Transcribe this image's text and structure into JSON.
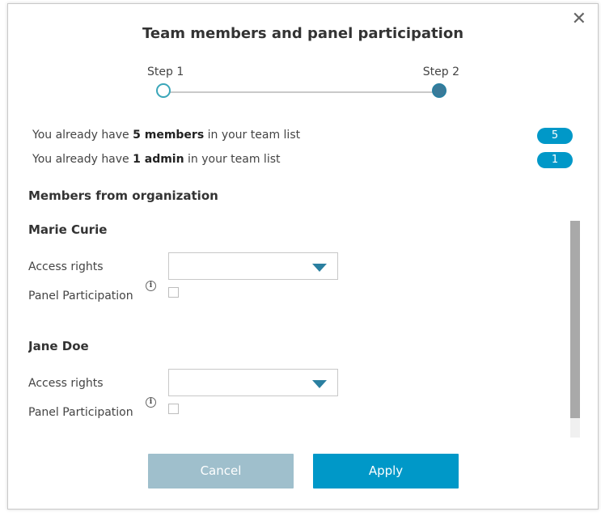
{
  "dialog": {
    "title": "Team members and panel participation",
    "close_glyph": "✕"
  },
  "stepper": {
    "steps": [
      {
        "label": "Step 1",
        "state": "complete"
      },
      {
        "label": "Step 2",
        "state": "active"
      }
    ]
  },
  "summary": {
    "members": {
      "prefix": "You already have ",
      "bold": "5 members",
      "suffix": " in your team list",
      "count": "5"
    },
    "admins": {
      "prefix": "You already have ",
      "bold": "1 admin",
      "suffix": " in your team list",
      "count": "1"
    }
  },
  "section": {
    "title": "Members from organization"
  },
  "members": [
    {
      "name": "Marie Curie",
      "access_label": "Access rights",
      "access_value": "",
      "panel_label": "Panel Participation",
      "panel_checked": false
    },
    {
      "name": "Jane Doe",
      "access_label": "Access rights",
      "access_value": "",
      "panel_label": "Panel Participation",
      "panel_checked": false
    }
  ],
  "buttons": {
    "cancel": "Cancel",
    "apply": "Apply"
  },
  "icons": {
    "close": "close-icon",
    "info": "info-icon",
    "caret": "chevron-down-icon"
  },
  "colors": {
    "accent": "#0098c8",
    "cancel_disabled": "#9fbfcc",
    "step_active": "#3a7a99",
    "step_done_border": "#3aa6b9"
  }
}
